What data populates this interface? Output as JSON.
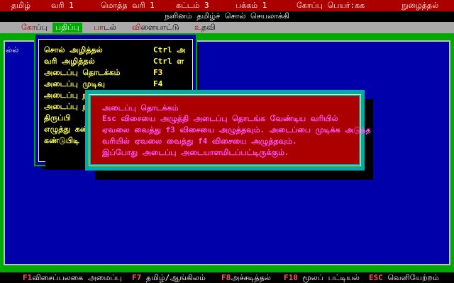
{
  "status_bar": {
    "language": "தமிழ்",
    "line": "வரி 1",
    "total_lines": "மொத்த வரி 1",
    "frame": "கட்டம் 3",
    "page": "பக்கம் 1",
    "file": "கோப்பு பெயர்:கக",
    "mode": "நுழைத்தல்"
  },
  "title": "நளினம் தமிழ்ச் சொல் செயலாக்கி",
  "menu": [
    {
      "hk": "க",
      "rest": "ோப்பு"
    },
    {
      "hk": "ப",
      "rest": "திப்பு"
    },
    {
      "hk": "பா",
      "rest": "டல்"
    },
    {
      "hk": "வி",
      "rest": "ளையாட்டு"
    },
    {
      "hk": "உ",
      "rest": "தவி"
    }
  ],
  "editor_text": "ல்ல்",
  "dropdown": [
    {
      "label": "சொல் அழித்தல்",
      "key": "Ctrl அ"
    },
    {
      "label": "வரி அழித்தல்",
      "key": "Ctrl ள"
    },
    {
      "label": "அடைப்பு தொடக்கம்",
      "key": "F3"
    },
    {
      "label": "அடைப்பு முடிவு",
      "key": "F4"
    },
    {
      "label": "அடைப்பு ந",
      "key": ""
    },
    {
      "label": "அடைப்பு ந",
      "key": ""
    },
    {
      "label": "திருப்பி",
      "key": ""
    },
    {
      "label": "எழுத்து கண்",
      "key": ""
    },
    {
      "label": "கண்டுபிடி",
      "key": ""
    }
  ],
  "dialog": {
    "title": "அடைப்பு தொடக்கம்",
    "lines": [
      "Esc விசையை அழுத்தி அடைப்பு தொடங்க வேண்டிய வரியில்",
      "ஏவலை வைத்து f3 விசையை அழுத்தவும். அடைப்பை முடிக்க அடுத்த",
      "வரியில் ஏவலை வைத்து f4 விசையை அழுத்தவும்.",
      "இப்போது அடைப்பு அடையாளமிடப்பட்டிருக்கும்."
    ]
  },
  "function_keys": [
    {
      "key": "F1",
      "label": "விசைப்பலகை அமைப்பு"
    },
    {
      "key": "F7",
      "label": "தமிழ்/ஆங்கிலம்"
    },
    {
      "key": "F8",
      "label": "அச்சடித்தல்"
    },
    {
      "key": "F10",
      "label": "மூலப் பட்டியல்"
    },
    {
      "key": "ESC",
      "label": "வெளியேற்றம்"
    }
  ]
}
